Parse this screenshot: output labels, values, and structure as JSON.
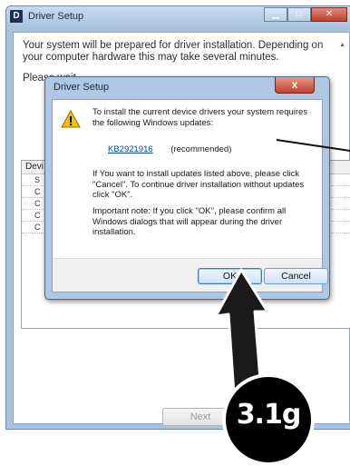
{
  "window": {
    "title": "Driver Setup",
    "app_icon_text": "D",
    "message": "Your system will be prepared for driver installation. Depending on your computer hardware this may take several minutes.",
    "please_wait": "Please wait...",
    "device_list_header": "Devi",
    "device_rows": [
      "S",
      "C",
      "C",
      "C",
      "C"
    ],
    "next_button": "Next"
  },
  "dialog": {
    "title": "Driver Setup",
    "close_glyph": "x",
    "intro": "To install the current device drivers your system requires the following Windows updates:",
    "update_link": "KB2921916",
    "update_note": "(recommended)",
    "paragraph_choice": "If You want to install updates listed above, please click \"Cancel\". To continue driver installation without updates click \"OK\".",
    "paragraph_note": "Important note: If you click \"OK\", please confirm all Windows dialogs that will appear during the driver installation.",
    "ok_button": "OK",
    "cancel_button": "Cancel"
  },
  "annotation": {
    "step_badge": "3.1g"
  },
  "colors": {
    "link": "#0645ad",
    "warning": "#f2c200",
    "badge_bg": "#000000"
  }
}
